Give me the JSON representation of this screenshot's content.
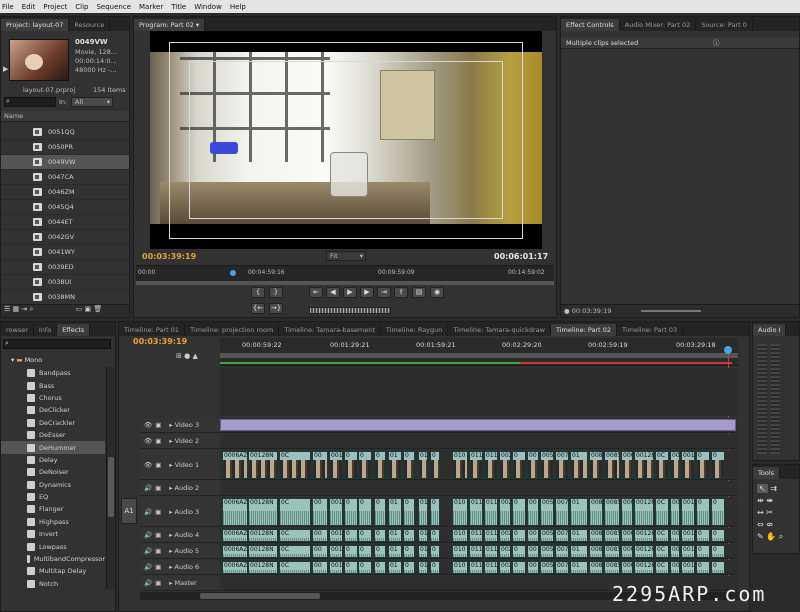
{
  "menu": [
    "File",
    "Edit",
    "Project",
    "Clip",
    "Sequence",
    "Marker",
    "Title",
    "Window",
    "Help"
  ],
  "project": {
    "tabs": [
      "Project: layout-07",
      "Resource"
    ],
    "clip_name": "0049VW",
    "clip_info": [
      "Movie, 128...",
      "00:00:14:0...",
      "48000 Hz -..."
    ],
    "project_file": "layout-07.prproj",
    "item_count": "154 Items",
    "in_label": "In:",
    "in_value": "All",
    "name_header": "Name",
    "items": [
      "0051QQ",
      "0050PR",
      "0049VW",
      "0047CA",
      "0046ZM",
      "0045Q4",
      "0044ET",
      "0042GV",
      "0041WY",
      "0039ED",
      "0038UI",
      "0038MN"
    ]
  },
  "program": {
    "tab": "Program: Part 02",
    "timecode_in": "00:03:39:19",
    "fit": "Fit",
    "timecode_dur": "00:06:01:17",
    "ruler": [
      "00:00",
      "00:04:59:16",
      "00:09:59:09",
      "00:14:59:02"
    ]
  },
  "effect_controls": {
    "tabs": [
      "Effect Controls",
      "Audio Mixer: Part 02",
      "Source: Part 0"
    ],
    "message": "Multiple clips selected",
    "bottom_tc": "00:03:39:19"
  },
  "effects": {
    "tabs": [
      "rowser",
      "Info",
      "Effects"
    ],
    "folder": "Mono",
    "items": [
      "Bandpass",
      "Bass",
      "Chorus",
      "DeClicker",
      "DeCrackler",
      "DeEsser",
      "DeHummer",
      "Delay",
      "DeNoiser",
      "Dynamics",
      "EQ",
      "Flanger",
      "Highpass",
      "Invert",
      "Lowpass",
      "MultibandCompressor",
      "Multitap Delay",
      "Notch"
    ]
  },
  "timeline": {
    "tabs": [
      "Timeline: Part 01",
      "Timeline: projection room",
      "Timeline: Tamara-basement",
      "Timeline: Raygun",
      "Timeline: Tamara-quickdraw",
      "Timeline: Part 02",
      "Timeline: Part 03"
    ],
    "timecode": "00:03:39:19",
    "ruler": [
      "00:00:59:22",
      "00:01:29:21",
      "00:01:59:21",
      "00:02:29:20",
      "00:02:59:19",
      "00:03:29:18"
    ],
    "tracks": [
      "Video 3",
      "Video 2",
      "Video 1",
      "Audio 2",
      "Audio 3",
      "Audio 4",
      "Audio 5",
      "Audio 6",
      "Master"
    ],
    "a1": "A1",
    "clip_labels": [
      "0006AZ",
      "00128N",
      "0C",
      "00",
      "001",
      "0",
      "0",
      "0",
      "01",
      "0",
      "014",
      "0",
      "010",
      "011",
      "011",
      "00229",
      "0",
      "00",
      "005351",
      "0076",
      "01",
      "008",
      "0085"
    ]
  },
  "audio_meter": {
    "tab": "Audio I"
  },
  "tools": {
    "tab": "Tools"
  },
  "watermark": "2295ARP.com",
  "colors": {
    "timecode": "#e8a23a",
    "accent": "#e8a23a",
    "audio_clip": "#9cc2bc",
    "video_clip": "#9cbfbf",
    "playhead": "#c83c3c"
  }
}
